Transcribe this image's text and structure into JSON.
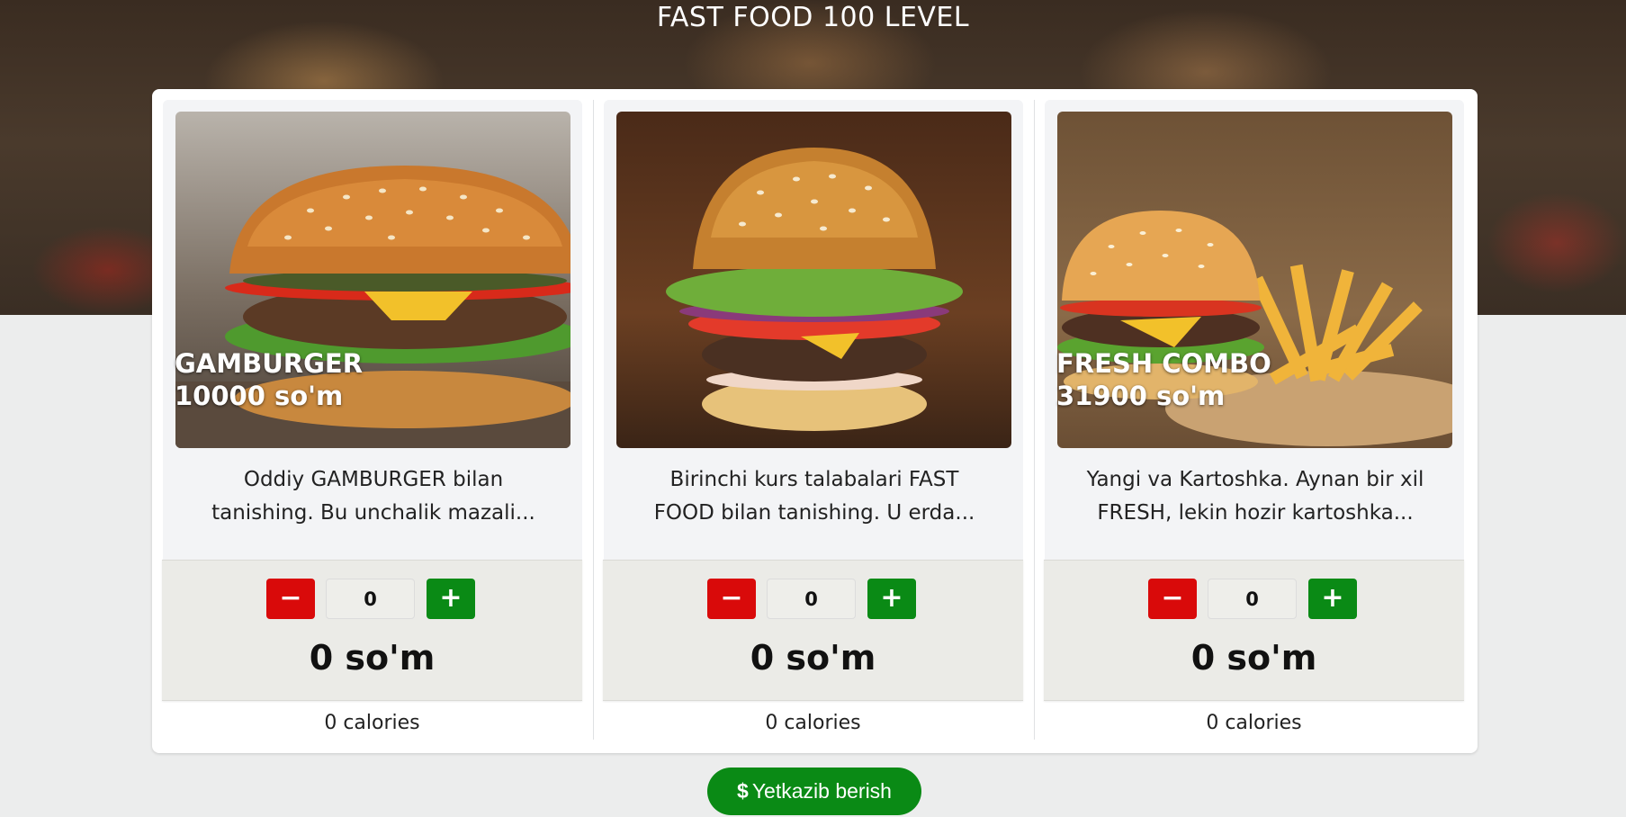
{
  "page": {
    "title": "FAST FOOD 100 LEVEL"
  },
  "cards": [
    {
      "name": "GAMBURGER",
      "price": "10000 so'm",
      "desc_line1": "Oddiy GAMBURGER bilan",
      "desc_line2": "tanishing. Bu unchalik mazali...",
      "minus_label": "−",
      "plus_label": "+",
      "quantity": "0",
      "total": "0 so'm",
      "calories": "0 calories",
      "image": "burger-photo"
    },
    {
      "name": "",
      "price": "",
      "desc_line1": "Birinchi kurs talabalari FAST",
      "desc_line2": "FOOD bilan tanishing. U erda...",
      "minus_label": "−",
      "plus_label": "+",
      "quantity": "0",
      "total": "0 so'm",
      "calories": "0 calories",
      "image": "burger-photo"
    },
    {
      "name": "FRESH COMBO",
      "price": "31900 so'm",
      "desc_line1": "Yangi va Kartoshka. Aynan bir xil",
      "desc_line2": "FRESH, lekin hozir kartoshka...",
      "minus_label": "−",
      "plus_label": "+",
      "quantity": "0",
      "total": "0 so'm",
      "calories": "0 calories",
      "image": "burger-fries-photo"
    }
  ],
  "delivery": {
    "icon": "dollar-icon",
    "symbol": "$",
    "label": "Yetkazib berish"
  },
  "colors": {
    "minus": "#d90a0a",
    "plus": "#0a8a15",
    "background": "#eceded"
  }
}
